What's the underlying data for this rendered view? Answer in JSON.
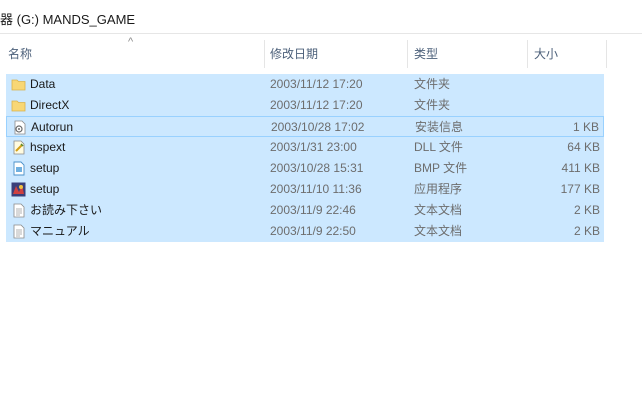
{
  "title": {
    "path": "器 (G:) MANDS_GAME"
  },
  "columns": {
    "name": "名称",
    "date": "修改日期",
    "type": "类型",
    "size": "大小",
    "sort_indicator": "^"
  },
  "files": [
    {
      "name": "Data",
      "date": "2003/11/12 17:20",
      "type": "文件夹",
      "size": "",
      "icon": "folder-icon"
    },
    {
      "name": "DirectX",
      "date": "2003/11/12 17:20",
      "type": "文件夹",
      "size": "",
      "icon": "folder-icon"
    },
    {
      "name": "Autorun",
      "date": "2003/10/28 17:02",
      "type": "安装信息",
      "size": "1 KB",
      "icon": "setup-info-icon"
    },
    {
      "name": "hspext",
      "date": "2003/1/31 23:00",
      "type": "DLL 文件",
      "size": "64 KB",
      "icon": "dll-icon"
    },
    {
      "name": "setup",
      "date": "2003/10/28 15:31",
      "type": "BMP 文件",
      "size": "411 KB",
      "icon": "bmp-icon"
    },
    {
      "name": "setup",
      "date": "2003/11/10 11:36",
      "type": "应用程序",
      "size": "177 KB",
      "icon": "application-icon"
    },
    {
      "name": "お読み下さい",
      "date": "2003/11/9 22:46",
      "type": "文本文档",
      "size": "2 KB",
      "icon": "text-document-icon"
    },
    {
      "name": "マニュアル",
      "date": "2003/11/9 22:50",
      "type": "文本文档",
      "size": "2 KB",
      "icon": "text-document-icon"
    }
  ],
  "colors": {
    "selection": "#cce8ff",
    "selection_border": "#99d1ff",
    "header_text": "#4c607a",
    "folder": "#f8d775"
  }
}
